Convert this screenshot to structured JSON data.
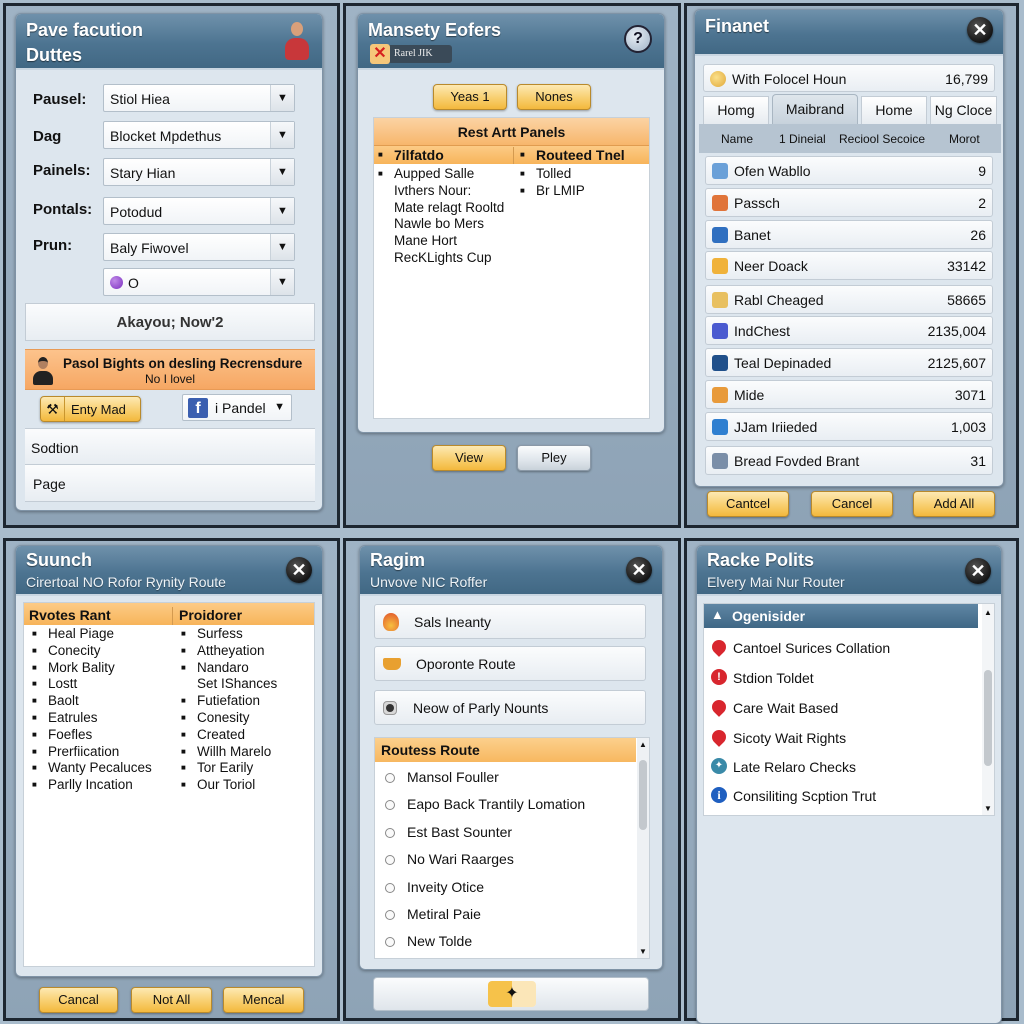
{
  "panel1": {
    "title": "Pave facution",
    "subtitle": "Duttes",
    "fields": [
      {
        "label": "Pausel:",
        "value": "Stiol Hiea"
      },
      {
        "label": "Dag",
        "value": "Blocket Mpdethus"
      },
      {
        "label": "Painels:",
        "value": "Stary Hian"
      },
      {
        "label": "Pontals:",
        "value": "Potodud"
      },
      {
        "label": "Prun:",
        "value": "Baly Fiwovel"
      },
      {
        "label": "",
        "value": "O"
      }
    ],
    "status_text": "Akayou; Now'2",
    "banner_line1": "Pasol Bights on desling Recrensdure",
    "banner_line2": "No I lovel",
    "entry_button": "Enty Mad",
    "social_select": "i Pandel",
    "section_row": "Sodtion",
    "page_row": "Page"
  },
  "panel2": {
    "title": "Mansety Eofers",
    "tag_label": "Rarel JIK",
    "buttons": [
      "Yeas 1",
      "Nones"
    ],
    "list_header": "Rest Artt Panels",
    "col1_header": "7ilfatdo",
    "col2_header": "Routeed Tnel",
    "col1_items": [
      {
        "text": "Aupped Salle",
        "bullet": true
      },
      {
        "text": "Ivthers Nour:",
        "bullet": false
      },
      {
        "text": "Mate relagt Rooltd",
        "bullet": false
      },
      {
        "text": "Nawle bo Mers",
        "bullet": false
      },
      {
        "text": "Mane Hort",
        "bullet": false
      },
      {
        "text": "RecKLights Cup",
        "bullet": false
      }
    ],
    "col2_items": [
      "Tolled",
      "Br LMIP"
    ],
    "footer_buttons": [
      "View",
      "Pley"
    ]
  },
  "panel3": {
    "title": "Finanet",
    "summary": {
      "label": "With Folocel Houn",
      "value": "16,799"
    },
    "tabs": [
      "Homg",
      "Maibrand",
      "Home",
      "Ng Cloce"
    ],
    "active_tab": "Maibrand",
    "columns": [
      "Name",
      "1 Dineial",
      "Reciool Secoice",
      "Morot"
    ],
    "rows": [
      {
        "name": "Ofen Wabllo",
        "value": "9",
        "icon": "folder-icon",
        "color": "#6aa0d8"
      },
      {
        "name": "Passch",
        "value": "2",
        "icon": "package-icon",
        "color": "#e0743a"
      },
      {
        "name": "Banet",
        "value": "26",
        "icon": "star-icon",
        "color": "#2f6fc0"
      },
      {
        "name": "Neer Doack",
        "value": "33142",
        "icon": "basket-icon",
        "color": "#f0b23a"
      },
      {
        "name": "Rabl Cheaged",
        "value": "58665",
        "icon": "box-icon",
        "color": "#e8c060"
      },
      {
        "name": "IndChest",
        "value": "2135,004",
        "icon": "gem-icon",
        "color": "#4a5ad0"
      },
      {
        "name": "Teal Depinaded",
        "value": "2125,607",
        "icon": "card-icon",
        "color": "#1f4f8a"
      },
      {
        "name": "Mide",
        "value": "3071",
        "icon": "book-icon",
        "color": "#e89a3a"
      },
      {
        "name": "JJam Iriieded",
        "value": "1,003",
        "icon": "arrow-icon",
        "color": "#2f7fd0"
      },
      {
        "name": "Bread Fovded Brant",
        "value": "31",
        "icon": "badge-icon",
        "color": "#7a8ea8"
      }
    ],
    "footer_buttons": [
      "Cantcel",
      "Cancel",
      "Add All"
    ]
  },
  "panel4": {
    "title": "Suunch",
    "subtitle": "Cirertoal NO Rofor Rynity Route",
    "col1_header": "Rvotes Rant",
    "col2_header": "Proidorer",
    "col1_items": [
      "Heal Piage",
      "Conecity",
      "Mork Bality",
      "Lostt",
      "Baolt",
      "Eatrules",
      "Foefles",
      "Prerfiication",
      "Wanty Pecaluces",
      "Parlly Incation"
    ],
    "col2_items": [
      {
        "text": "Surfess",
        "bullet": true
      },
      {
        "text": "Attheyation",
        "bullet": true
      },
      {
        "text": "Nandaro",
        "bullet": true
      },
      {
        "text": "Set IShances",
        "bullet": false
      },
      {
        "text": "Futiefation",
        "bullet": true
      },
      {
        "text": "Conesity",
        "bullet": true
      },
      {
        "text": "Created",
        "bullet": true
      },
      {
        "text": "Willh Marelo",
        "bullet": true
      },
      {
        "text": "Tor Earily",
        "bullet": true
      },
      {
        "text": "Our Toriol",
        "bullet": true
      }
    ],
    "footer_buttons": [
      "Cancal",
      "Not All",
      "Mencal"
    ]
  },
  "panel5": {
    "title": "Ragim",
    "subtitle": "Unvove NIC Roffer",
    "options": [
      {
        "label": "Sals Ineanty",
        "icon": "flame-icon"
      },
      {
        "label": "Oporonte Route",
        "icon": "basket-icon"
      },
      {
        "label": "Neow of Parly Nounts",
        "icon": "record-icon"
      }
    ],
    "list_header": "Routess Route",
    "list_items": [
      "Mansol Fouller",
      "Eapo Back Trantily Lomation",
      "Est Bast Sounter",
      "No Wari Raarges",
      "Inveity Otice",
      "Metiral Paie",
      "New Tolde"
    ]
  },
  "panel6": {
    "title": "Racke Polits",
    "subtitle": "Elvery Mai Nur Router",
    "list_header": "Ogenisider",
    "items": [
      {
        "label": "Cantoel Surices Collation",
        "icon": "map-pin-icon",
        "color": "#d8262e"
      },
      {
        "label": "Stdion Toldet",
        "icon": "alert-icon",
        "color": "#d8262e"
      },
      {
        "label": "Care Wait Based",
        "icon": "map-pin-icon",
        "color": "#d8262e"
      },
      {
        "label": "Sicoty Wait Rights",
        "icon": "map-pin-icon",
        "color": "#d8262e"
      },
      {
        "label": "Late Relaro Checks",
        "icon": "compass-icon",
        "color": "#3a8aa8"
      },
      {
        "label": "Consiliting Scption Trut",
        "icon": "info-icon",
        "color": "#1f5fc0"
      }
    ]
  }
}
